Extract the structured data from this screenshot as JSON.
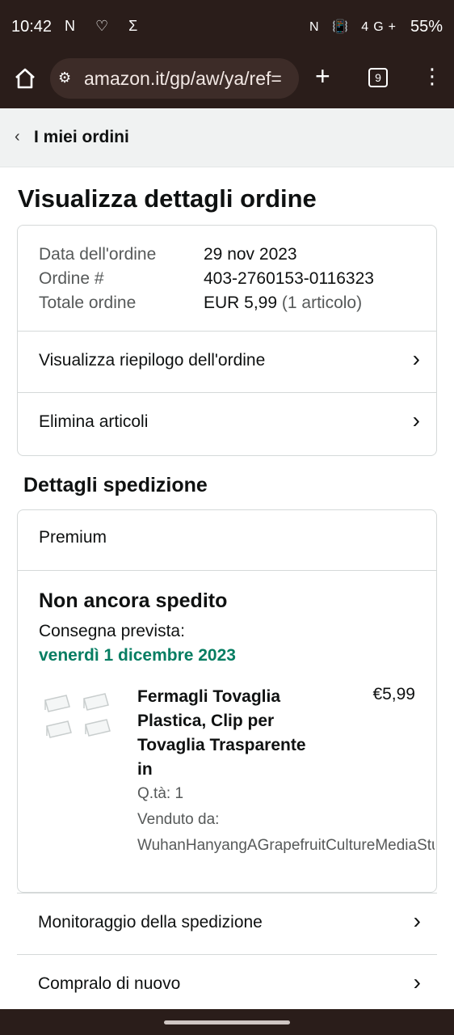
{
  "status_bar": {
    "time": "10:42",
    "left_icons": "N ♡ Σ",
    "right_icons": "N 📳 4G+",
    "battery": "55%"
  },
  "browser": {
    "url": "amazon.it/gp/aw/ya/ref=",
    "tabs_count": "9"
  },
  "nav": {
    "back_label": "I miei ordini"
  },
  "page": {
    "title": "Visualizza dettagli ordine"
  },
  "order": {
    "date_label": "Data dell'ordine",
    "date_value": "29 nov 2023",
    "number_label": "Ordine #",
    "number_value": "403-2760153-0116323",
    "total_label": "Totale ordine",
    "total_value": "EUR 5,99",
    "total_items": "(1 articolo)",
    "summary_link": "Visualizza riepilogo dell'ordine",
    "delete_link": "Elimina articoli"
  },
  "shipment": {
    "section_title": "Dettagli spedizione",
    "service": "Premium",
    "status": "Non ancora spedito",
    "delivery_label": "Consegna prevista:",
    "delivery_date": "venerdì 1 dicembre 2023",
    "item": {
      "title_lines": [
        "Fermagli Tovaglia",
        "Plastica, Clip per",
        "Tovaglia Trasparente",
        "in"
      ],
      "price": "€5,99",
      "qty": "Q.tà: 1",
      "sold_by_label": "Venduto da:",
      "seller": "WuhanHanyangAGrapefruitCultureMediaStudio"
    }
  },
  "actions": {
    "track": "Monitoraggio della spedizione",
    "buy_again": "Compralo di nuovo"
  },
  "colors": {
    "delivery_green": "#067D62",
    "browser_bar": "#2a1d1a"
  }
}
